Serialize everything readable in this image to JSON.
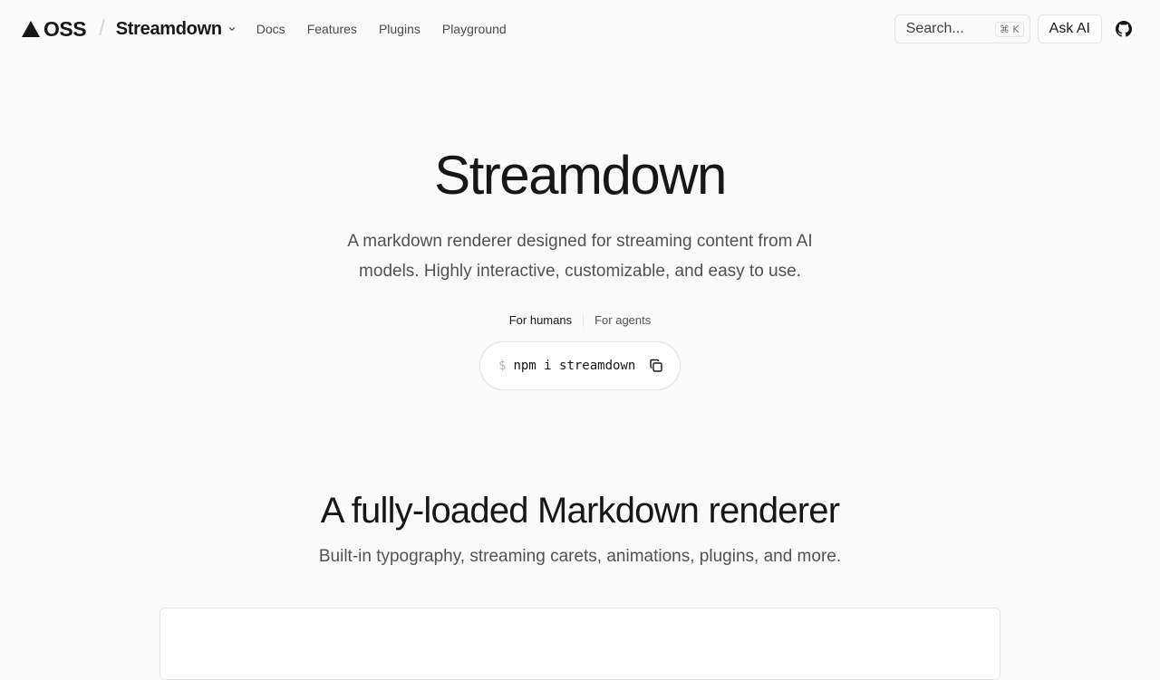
{
  "nav": {
    "brand": "OSS",
    "separator": "/",
    "product": "Streamdown",
    "links": [
      "Docs",
      "Features",
      "Plugins",
      "Playground"
    ],
    "search_placeholder": "Search...",
    "search_shortcut": "⌘ K",
    "ask_ai": "Ask AI"
  },
  "hero": {
    "title": "Streamdown",
    "subtitle": "A markdown renderer designed for streaming content from AI models. Highly interactive, customizable, and easy to use.",
    "tabs": [
      "For humans",
      "For agents"
    ],
    "active_tab": "For humans",
    "command_prompt": "$",
    "command": "npm i streamdown"
  },
  "features": {
    "title": "A fully-loaded Markdown renderer",
    "subtitle": "Built-in typography, streaming carets, animations, plugins, and more."
  },
  "icons": {
    "logo": "triangle-logo-icon",
    "product_menu": "chevron-down-icon",
    "github": "github-icon",
    "copy": "copy-icon"
  }
}
